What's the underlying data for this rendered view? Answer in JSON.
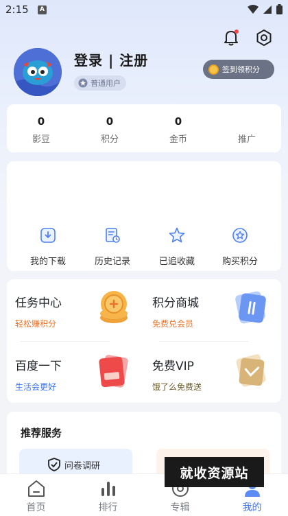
{
  "status_bar": {
    "time": "2:15",
    "notif_icon": "A"
  },
  "header": {
    "login_text": "登录 | 注册",
    "user_level": "普通用户",
    "signin_button": "签到领积分"
  },
  "stats": [
    {
      "value": "0",
      "label": "影豆"
    },
    {
      "value": "0",
      "label": "积分"
    },
    {
      "value": "0",
      "label": "金币"
    },
    {
      "value": "",
      "label": "推广"
    }
  ],
  "tools": [
    {
      "label": "我的下载",
      "icon": "download-icon"
    },
    {
      "label": "历史记录",
      "icon": "history-icon"
    },
    {
      "label": "已追收藏",
      "icon": "star-icon"
    },
    {
      "label": "购买积分",
      "icon": "buy-points-icon"
    }
  ],
  "features": {
    "task_center": {
      "title": "任务中心",
      "subtitle": "轻松赚积分",
      "color": "#e8742a"
    },
    "points_mall": {
      "title": "积分商城",
      "subtitle": "免费兑会员",
      "color": "#e8742a"
    },
    "baidu": {
      "title": "百度一下",
      "subtitle": "生活会更好",
      "color": "#3d72ef"
    },
    "free_vip": {
      "title": "免费VIP",
      "subtitle": "饿了么免费送",
      "color": "#6b5a2c"
    }
  },
  "recommend": {
    "title": "推荐服务",
    "item1_text": "问卷调研"
  },
  "tabs": [
    {
      "label": "首页",
      "icon": "home-icon"
    },
    {
      "label": "排行",
      "icon": "ranking-icon"
    },
    {
      "label": "专辑",
      "icon": "album-icon"
    },
    {
      "label": "我的",
      "icon": "profile-icon"
    }
  ],
  "watermark": "就收资源站",
  "colors": {
    "accent": "#3d72ef",
    "orange": "#e8742a"
  }
}
